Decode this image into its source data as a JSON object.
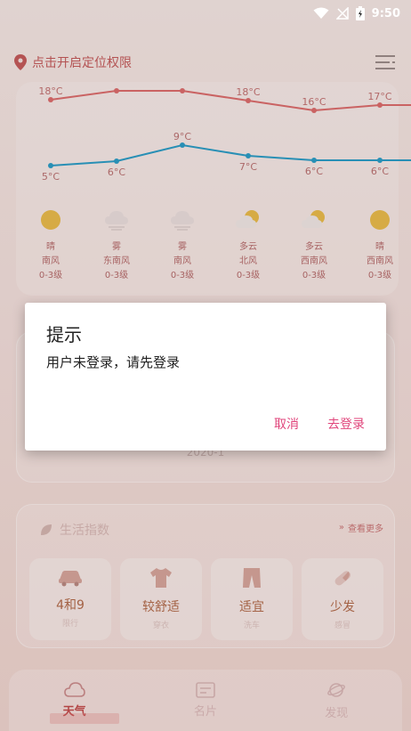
{
  "status_bar": {
    "time": "9:50"
  },
  "location": {
    "text": "点击开启定位权限"
  },
  "forecast": {
    "days": [
      {
        "high": "18°C",
        "low": "5°C",
        "weather": "晴",
        "icon": "sunny-icon",
        "wind_dir": "南风",
        "wind_level": "0-3级"
      },
      {
        "high": "",
        "low": "6°C",
        "weather": "雾",
        "icon": "fog-icon",
        "wind_dir": "东南风",
        "wind_level": "0-3级"
      },
      {
        "high": "",
        "low": "9°C",
        "weather": "雾",
        "icon": "fog-icon",
        "wind_dir": "南风",
        "wind_level": "0-3级"
      },
      {
        "high": "18°C",
        "low": "7°C",
        "weather": "多云",
        "icon": "partly-cloudy-icon",
        "wind_dir": "北风",
        "wind_level": "0-3级"
      },
      {
        "high": "16°C",
        "low": "6°C",
        "weather": "多云",
        "icon": "partly-cloudy-icon",
        "wind_dir": "西南风",
        "wind_level": "0-3级"
      },
      {
        "high": "17°C",
        "low": "6°C",
        "weather": "晴",
        "icon": "sunny-icon",
        "wind_dir": "西南风",
        "wind_level": "0-3级"
      }
    ],
    "colors": {
      "high_line": "#d96b6b",
      "low_line": "#2a9bc4"
    }
  },
  "aqi": {
    "date": "2020-1"
  },
  "life_index": {
    "title": "生活指数",
    "more": "查看更多",
    "items": [
      {
        "value": "4和9",
        "label": "限行",
        "icon": "car-icon"
      },
      {
        "value": "较舒适",
        "label": "穿衣",
        "icon": "clothes-icon"
      },
      {
        "value": "适宜",
        "label": "洗车",
        "icon": "pants-icon"
      },
      {
        "value": "少发",
        "label": "感冒",
        "icon": "pill-icon"
      }
    ]
  },
  "bottom_nav": [
    {
      "label": "天气",
      "icon": "cloud-icon",
      "active": true
    },
    {
      "label": "名片",
      "icon": "card-icon",
      "active": false
    },
    {
      "label": "发现",
      "icon": "planet-icon",
      "active": false
    }
  ],
  "dialog": {
    "title": "提示",
    "message": "用户未登录，请先登录",
    "cancel_label": "取消",
    "confirm_label": "去登录",
    "accent_color": "#e0457b"
  }
}
